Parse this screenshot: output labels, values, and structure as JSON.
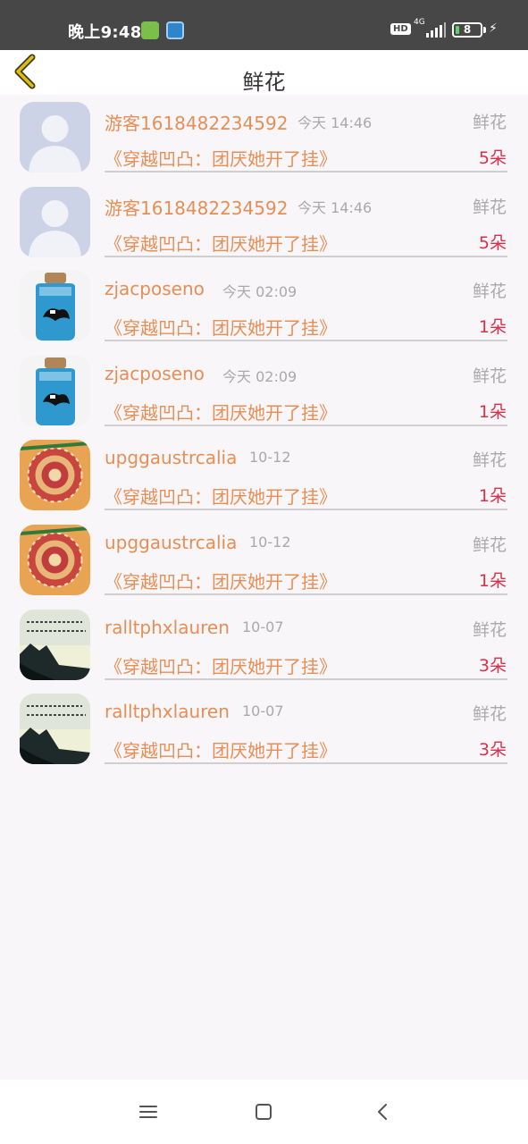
{
  "status_bar": {
    "time": "晚上9:48",
    "hd": "HD",
    "network": "4G",
    "battery": "8"
  },
  "header": {
    "title": "鲜花"
  },
  "items": [
    {
      "username": "游客1618482234592",
      "time": "今天 14:46",
      "gift_type": "鲜花",
      "book_title": "《穿越凹凸：团厌她开了挂》",
      "count": "5朵",
      "avatar": "default-avatar"
    },
    {
      "username": "游客1618482234592",
      "time": "今天 14:46",
      "gift_type": "鲜花",
      "book_title": "《穿越凹凸：团厌她开了挂》",
      "count": "5朵",
      "avatar": "default-avatar"
    },
    {
      "username": "zjacposeno",
      "time": "今天 02:09",
      "gift_type": "鲜花",
      "book_title": "《穿越凹凸：团厌她开了挂》",
      "count": "1朵",
      "avatar": "bottle-avatar"
    },
    {
      "username": "zjacposeno",
      "time": "今天 02:09",
      "gift_type": "鲜花",
      "book_title": "《穿越凹凸：团厌她开了挂》",
      "count": "1朵",
      "avatar": "bottle-avatar"
    },
    {
      "username": "upggaustrcalia",
      "time": "10-12",
      "gift_type": "鲜花",
      "book_title": "《穿越凹凸：团厌她开了挂》",
      "count": "1朵",
      "avatar": "mandala-avatar"
    },
    {
      "username": "upggaustrcalia",
      "time": "10-12",
      "gift_type": "鲜花",
      "book_title": "《穿越凹凸：团厌她开了挂》",
      "count": "1朵",
      "avatar": "mandala-avatar"
    },
    {
      "username": "ralltphxlauren",
      "time": "10-07",
      "gift_type": "鲜花",
      "book_title": "《穿越凹凸：团厌她开了挂》",
      "count": "3朵",
      "avatar": "landscape-avatar"
    },
    {
      "username": "ralltphxlauren",
      "time": "10-07",
      "gift_type": "鲜花",
      "book_title": "《穿越凹凸：团厌她开了挂》",
      "count": "3朵",
      "avatar": "landscape-avatar"
    }
  ],
  "colors": {
    "accent": "#e88e55",
    "count": "#d9304b",
    "muted": "#aaaaaa",
    "back_arrow": "#d7b400"
  },
  "icons": {
    "back": "chevron-left-icon",
    "nav_menu": "menu-icon",
    "nav_home": "square-icon",
    "nav_back": "back-triangle-icon"
  }
}
